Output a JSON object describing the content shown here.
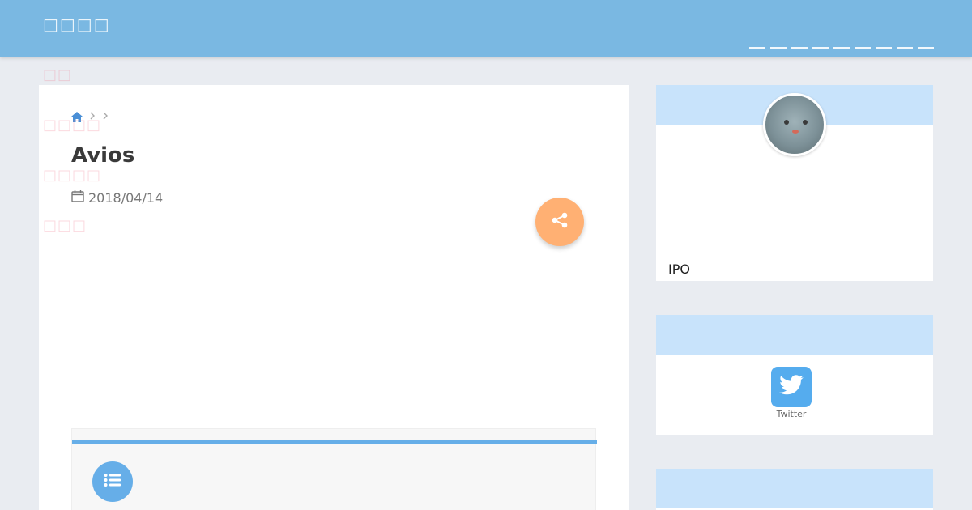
{
  "site": {
    "title": "□□□□"
  },
  "nav": {
    "items": [
      "",
      "",
      "",
      "",
      "",
      "",
      "",
      "",
      ""
    ]
  },
  "ghost_labels": [
    "□□",
    "□□□□",
    "□□□□",
    "□□□"
  ],
  "article": {
    "title": "Avios",
    "date": "2018/04/14"
  },
  "sidebar": {
    "profile_text": "IPO",
    "twitter_label": "Twitter"
  },
  "colors": {
    "header": "#7ab8e2",
    "accent": "#66aee8",
    "share": "#ffb073",
    "widget_head": "#c8e3fb",
    "twitter": "#55acee"
  },
  "icons": [
    "home-icon",
    "chevron-right-icon",
    "calendar-icon",
    "share-icon",
    "list-icon",
    "twitter-icon"
  ]
}
